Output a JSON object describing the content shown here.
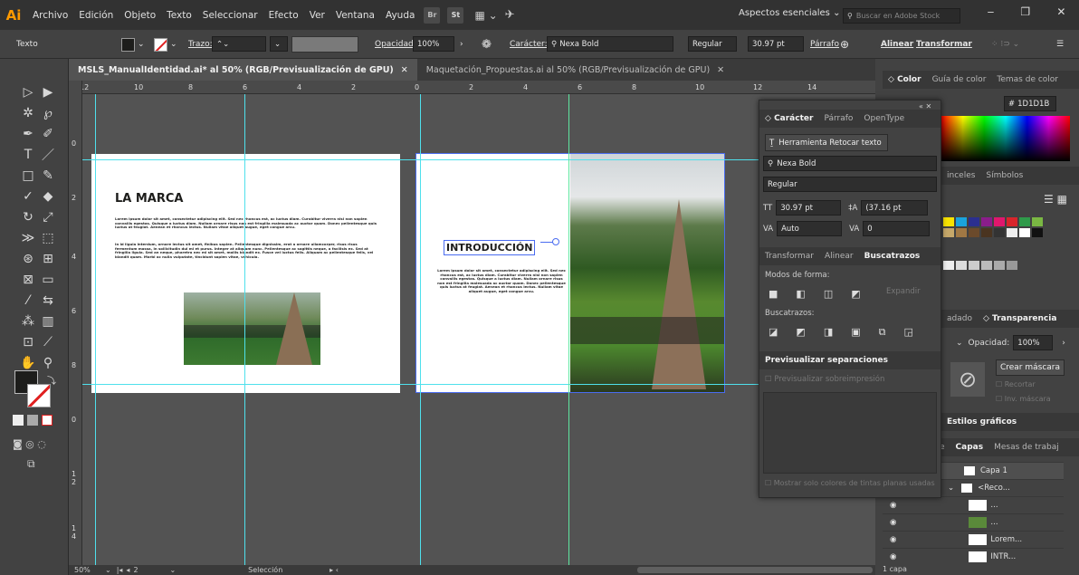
{
  "app": {
    "logo": "Ai"
  },
  "menu": [
    "Archivo",
    "Edición",
    "Objeto",
    "Texto",
    "Seleccionar",
    "Efecto",
    "Ver",
    "Ventana",
    "Ayuda"
  ],
  "menubar_icons": [
    "Br",
    "St"
  ],
  "workspace": "Aspectos esenciales",
  "stock_search_placeholder": "Buscar en Adobe Stock",
  "control": {
    "label": "Texto",
    "stroke_label": "Trazo:",
    "opacity_label": "Opacidad:",
    "opacity_value": "100%",
    "char_label": "Carácter:",
    "font": "Nexa Bold",
    "style": "Regular",
    "size": "30.97 pt",
    "para_label": "Párrafo",
    "align_label": "Alinear",
    "transform_label": "Transformar"
  },
  "tabs": [
    "MSLS_ManualIdentidad.ai* al 50% (RGB/Previsualización de GPU)",
    "Maquetación_Propuestas.ai al 50% (RGB/Previsualización de GPU)"
  ],
  "ruler_h": [
    "12",
    "10",
    "8",
    "6",
    "4",
    "2",
    "0",
    "2",
    "4",
    "6",
    "8",
    "10",
    "12",
    "14"
  ],
  "ruler_v": [
    "0",
    "2",
    "4",
    "6",
    "8",
    "0",
    "1 2",
    "1 4"
  ],
  "artboard1": {
    "title": "LA MARCA",
    "para1": "Lorem ipsum dolor sit amet, consectetur adipiscing elit. Sed nec rhoncus est, ac luctus diam. Curabitur viverra nisi non sapien convallis egestas. Quisque a luctus diam. Nullam ornare risus non est fringilla malesuada ac auctor quam. Donec pellentesque quis luctus at feugiat. Aenean et rhoncus lectus. Nullam vitae aliquet augue, eget congue arcu.",
    "para2": "In id ligula interdum, ornare lectus sit amet, finibus sapien. Pellentesque dignissim, erat a ornare ullamcorper, risus risus fermentum massa, in sollicitudin dui mi et purus. Integer at aliquam nunc. Pellentesque ac sagittis neque, a facilisis ex. Sed at fringilla ligula. Sed an neque, pharetra nec mi sit amet, mollis blandit ex. Fusce vel luctus felis. Aliquam ac pellentesque felis, vel blandit quam. Morbi ac nulla vulputate, tincidunt sapien vitae, vehicula."
  },
  "artboard2": {
    "title": "INTRODUCCIÓN",
    "para": "Lorem ipsum dolor sit amet, consectetur adipiscing elit. Sed nec rhoncus est, ac luctus diam. Curabitur viverra nisi non sapien convallis egestas. Quisque a luctus diam. Nullam ornare risus non est fringilla malesuada ac auctor quam. Donec pellentesque quis luctus at feugiat. Aenean et rhoncus lectus. Nullam vitae aliquet augue, eget congue arcu."
  },
  "character_panel": {
    "tabs": [
      "Carácter",
      "Párrafo",
      "OpenType"
    ],
    "touch_tool": "Herramienta Retocar texto",
    "font": "Nexa Bold",
    "style": "Regular",
    "size": "30.97 pt",
    "leading": "(37.16 pt",
    "kerning": "Auto",
    "tracking": "0",
    "sub_tabs": [
      "Transformar",
      "Alinear",
      "Buscatrazos"
    ],
    "shape_modes": "Modos de forma:",
    "expand": "Expandir",
    "pathfinders": "Buscatrazos:",
    "sep_title": "Previsualizar separaciones",
    "overprint": "Previsualizar sobreimpresión",
    "spot_only": "Mostrar solo colores de tintas planas usadas"
  },
  "color_panel": {
    "tabs": [
      "Color",
      "Guía de color",
      "Temas de color"
    ],
    "hex": "1D1D1B"
  },
  "swatch_tabs": [
    "inceles",
    "Símbolos"
  ],
  "transparency": {
    "tabs": [
      "adado",
      "Transparencia"
    ],
    "opacity_label": "Opacidad:",
    "opacity_value": "100%",
    "make_mask": "Crear máscara",
    "clip": "Recortar",
    "invert": "Inv. máscara"
  },
  "graphic_styles": "Estilos gráficos",
  "layers": {
    "tabs": [
      "e",
      "Capas",
      "Mesas de trabaj"
    ],
    "rows": [
      "Capa 1",
      "<Reco...",
      "...",
      "...",
      "Lorem...",
      "INTR..."
    ],
    "footer": "1 capa"
  },
  "status": {
    "zoom": "50%",
    "page": "2",
    "tool": "Selección"
  },
  "colors": {
    "guide": "#4fe0ec",
    "selection": "#4a6cf0",
    "accent": "#ff9a00",
    "current_color": "#1D1D1B"
  }
}
